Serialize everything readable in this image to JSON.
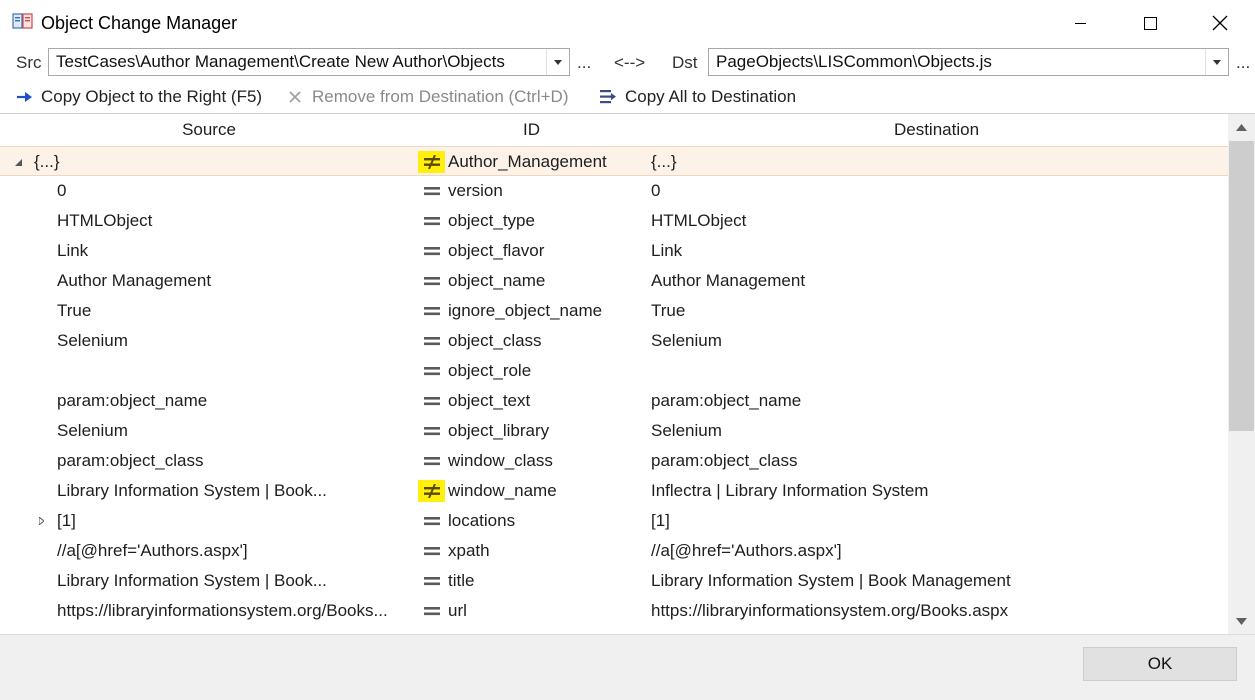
{
  "window": {
    "title": "Object Change Manager",
    "controls": {
      "minimize": "minimize",
      "maximize": "maximize",
      "close": "close"
    }
  },
  "paths": {
    "src_label": "Src",
    "src_value": "TestCases\\Author Management\\Create New Author\\Objects",
    "src_browse": "...",
    "swap_label": "<-->",
    "dst_label": "Dst",
    "dst_value": "PageObjects\\LISCommon\\Objects.js",
    "dst_browse": "..."
  },
  "toolbar": {
    "copy_right": "Copy Object to the Right (F5)",
    "remove_dest": "Remove from Destination (Ctrl+D)",
    "copy_all": "Copy All to Destination"
  },
  "columns": {
    "source": "Source",
    "id": "ID",
    "destination": "Destination"
  },
  "rows": [
    {
      "source": "{...}",
      "id": "Author_Management",
      "dest": "{...}"
    },
    {
      "source": "0",
      "id": "version",
      "dest": "0"
    },
    {
      "source": "HTMLObject",
      "id": "object_type",
      "dest": "HTMLObject"
    },
    {
      "source": "Link",
      "id": "object_flavor",
      "dest": "Link"
    },
    {
      "source": "Author Management",
      "id": "object_name",
      "dest": "Author Management"
    },
    {
      "source": "True",
      "id": "ignore_object_name",
      "dest": "True"
    },
    {
      "source": "Selenium",
      "id": "object_class",
      "dest": "Selenium"
    },
    {
      "source": "",
      "id": "object_role",
      "dest": ""
    },
    {
      "source": "param:object_name",
      "id": "object_text",
      "dest": "param:object_name"
    },
    {
      "source": "Selenium",
      "id": "object_library",
      "dest": "Selenium"
    },
    {
      "source": "param:object_class",
      "id": "window_class",
      "dest": "param:object_class"
    },
    {
      "source": "Library Information System | Book...",
      "id": "window_name",
      "dest": "Inflectra | Library Information System"
    },
    {
      "source": "[1]",
      "id": "locations",
      "dest": "[1]"
    },
    {
      "source": "//a[@href='Authors.aspx']",
      "id": "xpath",
      "dest": "//a[@href='Authors.aspx']"
    },
    {
      "source": "Library Information System | Book...",
      "id": "title",
      "dest": "Library Information System | Book Management"
    },
    {
      "source": "https://libraryinformationsystem.org/Books...",
      "id": "url",
      "dest": "https://libraryinformationsystem.org/Books.aspx"
    }
  ],
  "footer": {
    "ok": "OK"
  },
  "colors": {
    "highlight": "#ffef0a",
    "selected_row": "#fdf2e7",
    "equal_icon": "#5a5a5a",
    "copy_arrow": "#1f4fc9"
  }
}
